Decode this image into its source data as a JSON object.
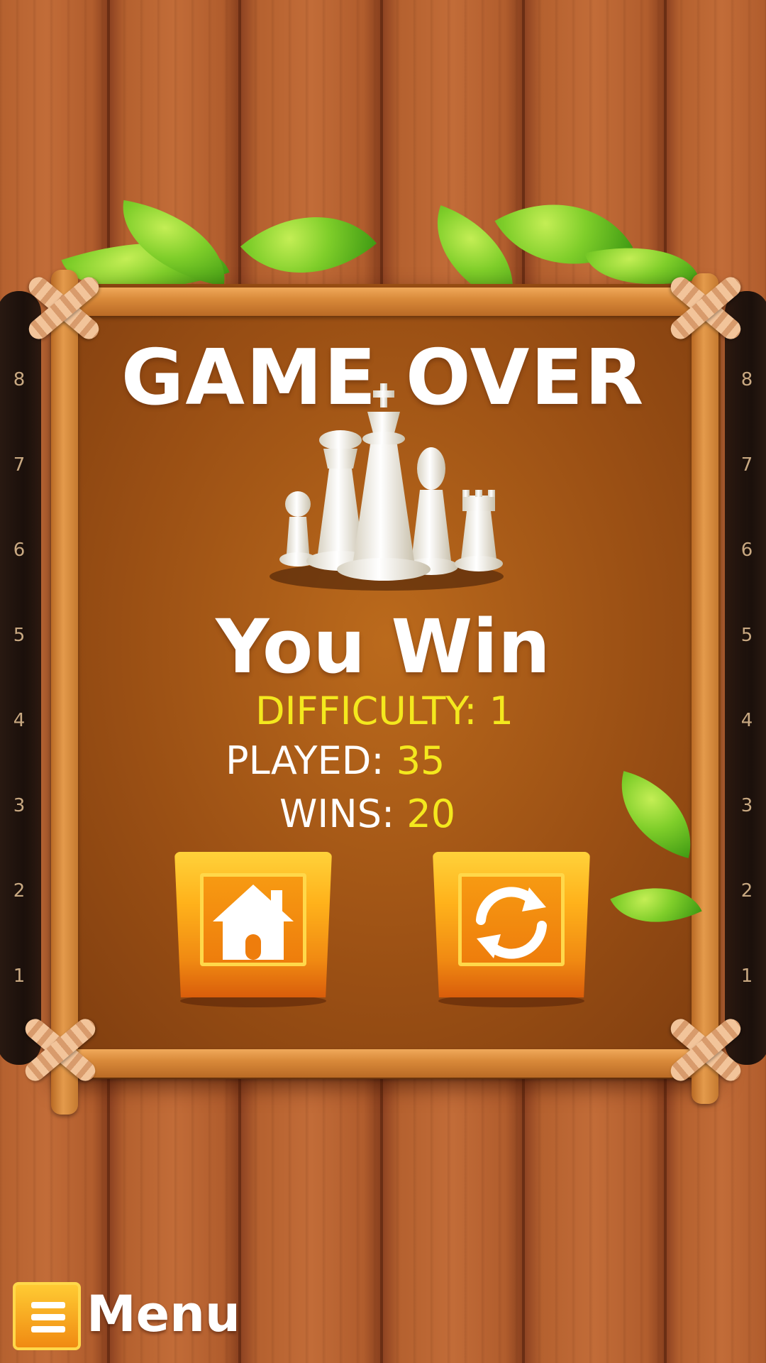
{
  "screen": {
    "title": "GAME OVER",
    "result": "You Win"
  },
  "stats": {
    "difficulty_label": "DIFFICULTY:",
    "difficulty_value": "1",
    "played_label": "PLAYED:",
    "played_value": "35",
    "wins_label": "WINS:",
    "wins_value": "20"
  },
  "board_ranks": [
    "8",
    "7",
    "6",
    "5",
    "4",
    "3",
    "2",
    "1"
  ],
  "buttons": {
    "home_icon": "home-icon",
    "restart_icon": "restart-icon"
  },
  "menu": {
    "label": "Menu",
    "icon": "hamburger-icon"
  },
  "colors": {
    "accent_yellow": "#f4e81e",
    "button_orange": "#f79a12",
    "text_white": "#ffffff"
  }
}
